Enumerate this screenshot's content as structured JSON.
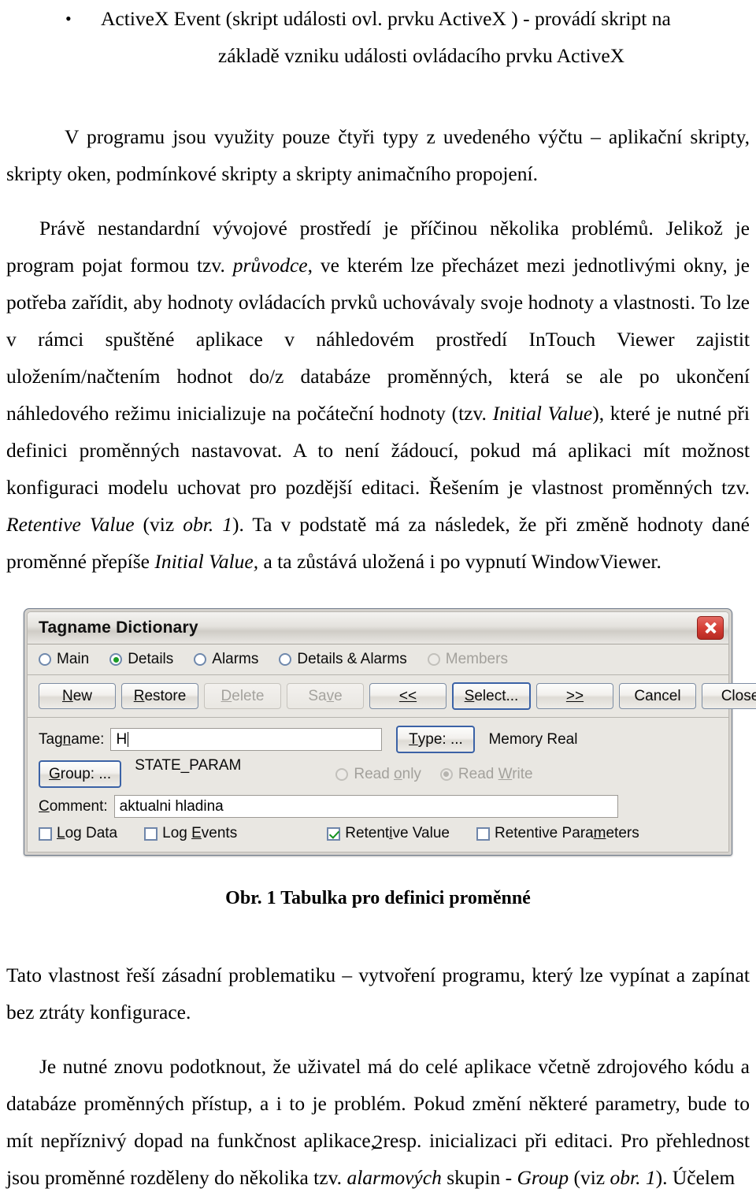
{
  "document": {
    "bullet": {
      "line1": "ActiveX Event (skript události ovl. prvku ActiveX ) - provádí skript na",
      "line2": "základě vzniku události ovládacího prvku ActiveX"
    },
    "para1": "V  programu jsou využity pouze čtyři typy z uvedeného výčtu – aplikační skripty, skripty oken, podmínkové skripty a skripty animačního propojení.",
    "para2": {
      "a": "Právě nestandardní vývojové prostředí je příčinou několika problémů. Jelikož je program pojat formou tzv. ",
      "i1": "průvodce",
      "b": ", ve kterém lze přecházet mezi jednotlivými okny, je potřeba zařídit, aby hodnoty ovládacích prvků uchovávaly svoje hodnoty a vlastnosti. To lze v rámci spuštěné aplikace v náhledovém prostředí InTouch Viewer zajistit uložením/načtením hodnot do/z databáze proměnných, která se ale po ukončení náhledového režimu inicializuje na počáteční hodnoty (tzv. ",
      "i2": "Initial Value",
      "c": "), které je nutné při definici proměnných nastavovat. A to není žádoucí, pokud má aplikaci mít možnost konfiguraci modelu uchovat pro pozdější editaci.  Řešením  je  vlastnost proměnných tzv. ",
      "i3": "Retentive Value",
      "d": " (viz ",
      "i4": "obr. 1",
      "e": "). Ta v podstatě má za následek, že při změně hodnoty dané proměnné přepíše ",
      "i5": "Initial Value,",
      "f": " a ta zůstává uložená i po vypnutí WindowViewer."
    },
    "figure_caption": "Obr. 1 Tabulka pro definici proměnné",
    "para3": "Tato vlastnost řeší zásadní problematiku – vytvoření programu, který lze vypínat a zapínat bez ztráty konfigurace.",
    "para4": {
      "a": "Je nutné znovu podotknout, že uživatel má do celé aplikace včetně zdrojového kódu a databáze proměnných přístup, a i to je problém. Pokud změní některé parametry, bude to mít nepříznivý dopad na funkčnost aplikace, resp. inicializaci při editaci. Pro přehlednost jsou proměnné rozděleny do několika tzv. ",
      "i1": "alarmových",
      "b": " skupin - ",
      "i2": "Group",
      "c": " (viz ",
      "i3": "obr. 1",
      "d": "). Účelem"
    },
    "page_number": "2"
  },
  "dialog": {
    "title": "Tagname Dictionary",
    "close_icon": "close-icon",
    "view_modes": [
      {
        "label": "Main",
        "checked": false,
        "disabled": false
      },
      {
        "label": "Details",
        "checked": true,
        "disabled": false
      },
      {
        "label": "Alarms",
        "checked": false,
        "disabled": false
      },
      {
        "label": "Details & Alarms",
        "checked": false,
        "disabled": false
      },
      {
        "label": "Members",
        "checked": false,
        "disabled": true
      }
    ],
    "buttons": {
      "new": "New",
      "new_accel": "N",
      "restore": "Restore",
      "restore_accel": "R",
      "delete": "Delete",
      "delete_accel": "D",
      "save": "Save",
      "save_accel": "v",
      "prev": "<<",
      "select": "Select...",
      "select_accel": "S",
      "next": ">>",
      "cancel": "Cancel",
      "close": "Close"
    },
    "fields": {
      "tagname_label": "Tagname:",
      "tagname_value": "H",
      "type_button": "Type: ...",
      "type_value": "Memory Real",
      "group_button": "Group: ...",
      "group_value": "STATE_PARAM",
      "comment_label": "Comment:",
      "comment_value": "aktualni hladina"
    },
    "access_radios": [
      {
        "label": "Read only",
        "checked": false,
        "disabled": true
      },
      {
        "label": "Read Write",
        "checked": true,
        "disabled": true
      }
    ],
    "checkboxes": [
      {
        "label": "Log Data",
        "checked": false
      },
      {
        "label": "Log Events",
        "checked": false
      },
      {
        "label": "Retentive Value",
        "checked": true
      },
      {
        "label": "Retentive Parameters",
        "checked": false
      }
    ],
    "colors": {
      "face": "#e9e7e2",
      "close_red": "#d63f36",
      "check_green": "#14931f",
      "focus_blue": "#3b62a6"
    }
  }
}
